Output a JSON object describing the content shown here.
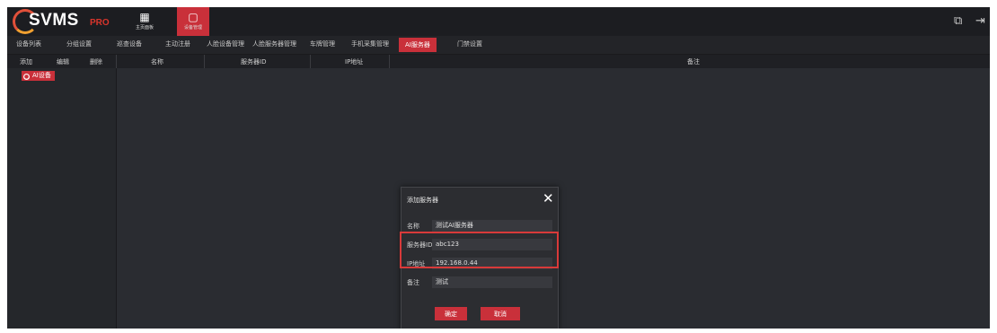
{
  "app": {
    "logo_main": "SVMS",
    "logo_sub": "PRO"
  },
  "modules": [
    {
      "label": "主页面板",
      "icon": "dashboard-icon",
      "active": false
    },
    {
      "label": "设备管理",
      "icon": "device-icon",
      "active": true
    }
  ],
  "top_icons": [
    "fullscreen-icon",
    "logout-icon"
  ],
  "nav": [
    {
      "label": "设备列表"
    },
    {
      "label": "分组设置"
    },
    {
      "label": "巡查设备"
    },
    {
      "label": "主动注册"
    },
    {
      "label": "人脸设备管理"
    },
    {
      "label": "人脸服务器管理"
    },
    {
      "label": "车牌管理"
    },
    {
      "label": "手机采集管理"
    },
    {
      "label": "AI服务器",
      "active": true
    },
    {
      "label": "门禁设置"
    }
  ],
  "left_toolbar": {
    "add": "添加",
    "edit": "编辑",
    "delete": "删除"
  },
  "table_headers": {
    "name": "名称",
    "server_id": "服务器ID",
    "ip": "IP地址",
    "remark": "备注"
  },
  "tree": {
    "root": "AI设备"
  },
  "dialog": {
    "title": "添加服务器",
    "close_icon": "✕",
    "fields": [
      {
        "label": "名称",
        "value": "测试AI服务器"
      },
      {
        "label": "服务器ID",
        "value": "abc123"
      },
      {
        "label": "IP地址",
        "value": "192.168.0.44"
      },
      {
        "label": "备注",
        "value": "测试"
      }
    ],
    "confirm": "确定",
    "cancel": "取消"
  },
  "colors": {
    "accent": "#c9303a",
    "highlight_box": "#d83a3a",
    "background": "#2a2c31"
  }
}
